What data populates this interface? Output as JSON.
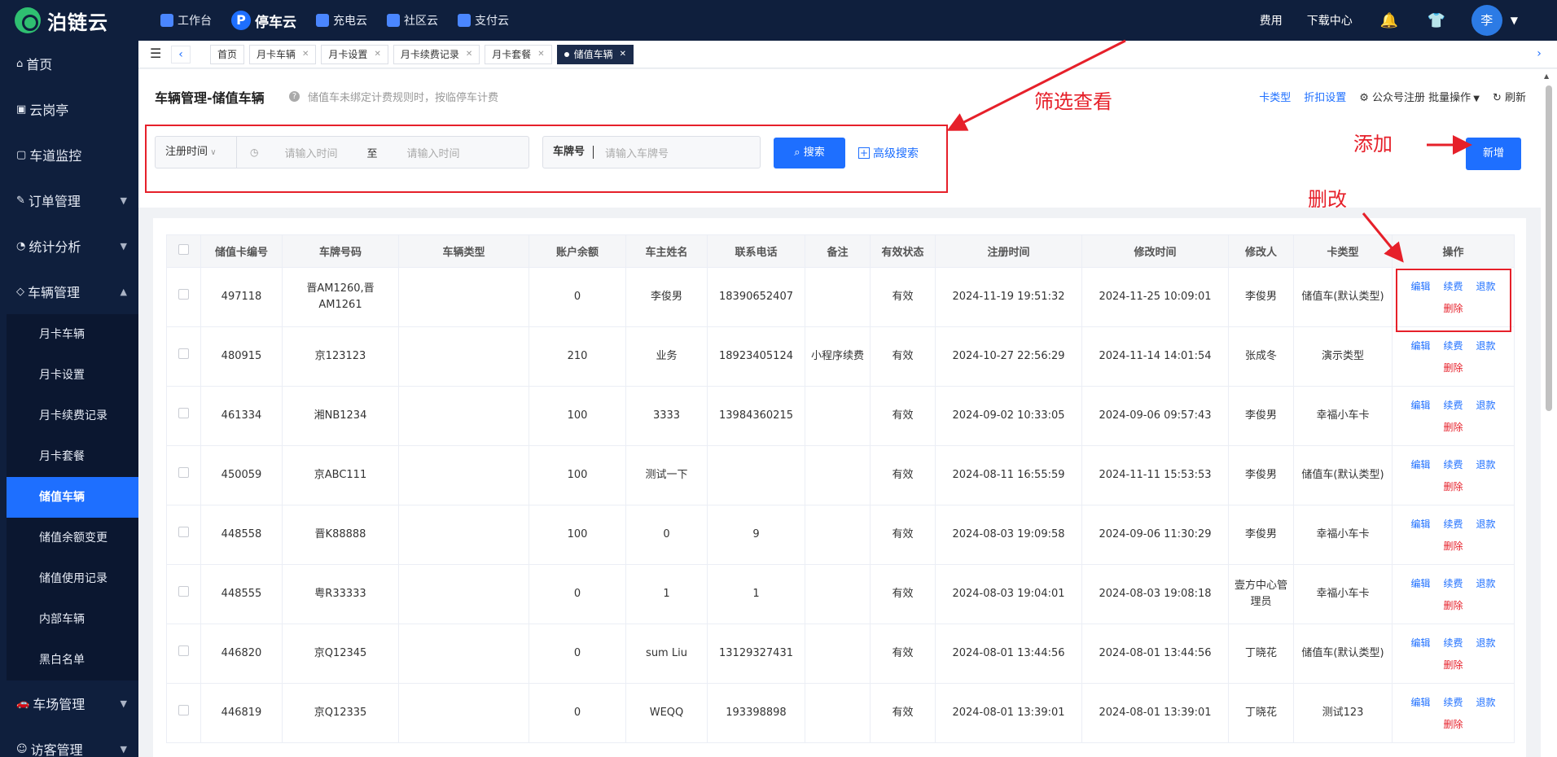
{
  "header": {
    "logo_text": "泊链云",
    "nav": [
      {
        "label": "工作台"
      },
      {
        "label": "停车云",
        "icon_text": "P"
      },
      {
        "label": "充电云"
      },
      {
        "label": "社区云"
      },
      {
        "label": "支付云"
      }
    ],
    "fees": "费用",
    "download": "下载中心",
    "avatar_text": "李"
  },
  "sidebar": {
    "items": {
      "home": "首页",
      "cloud_booth": "云岗亭",
      "lane_monitor": "车道监控",
      "orders": "订单管理",
      "stats": "统计分析",
      "vehicles": "车辆管理",
      "parking": "车场管理",
      "visitors": "访客管理"
    },
    "vehicle_sub": [
      "月卡车辆",
      "月卡设置",
      "月卡续费记录",
      "月卡套餐",
      "储值车辆",
      "储值余额变更",
      "储值使用记录",
      "内部车辆",
      "黑白名单"
    ]
  },
  "tabs": [
    "首页",
    "月卡车辆",
    "月卡设置",
    "月卡续费记录",
    "月卡套餐",
    "储值车辆"
  ],
  "page": {
    "title": "车辆管理-储值车辆",
    "help": "储值车未绑定计费规则时，按临停车计费",
    "links": {
      "card_type": "卡类型",
      "discount": "折扣设置",
      "wechat_reg": "公众号注册",
      "batch": "批量操作",
      "refresh": "刷新"
    }
  },
  "filter": {
    "date_type": "注册时间",
    "start_ph": "请输入时间",
    "to": "至",
    "end_ph": "请输入时间",
    "plate_label": "车牌号",
    "plate_ph": "请输入车牌号",
    "search": "搜索",
    "advanced": "高级搜索"
  },
  "add_button": "新增",
  "annotations": {
    "filter": "筛选查看",
    "add": "添加",
    "edit": "删改"
  },
  "table": {
    "columns": [
      "储值卡编号",
      "车牌号码",
      "车辆类型",
      "账户余额",
      "车主姓名",
      "联系电话",
      "备注",
      "有效状态",
      "注册时间",
      "修改时间",
      "修改人",
      "卡类型",
      "操作"
    ],
    "actions": {
      "edit": "编辑",
      "renew": "续费",
      "refund": "退款",
      "delete": "删除"
    },
    "rows": [
      {
        "id": "497118",
        "plate": "晋AM1260,晋AM1261",
        "vtype": "",
        "balance": "0",
        "owner": "李俊男",
        "phone": "18390652407",
        "note": "",
        "status": "有效",
        "reg": "2024-11-19 19:51:32",
        "mod": "2024-11-25 10:09:01",
        "modifier": "李俊男",
        "ctype": "储值车(默认类型)"
      },
      {
        "id": "480915",
        "plate": "京123123",
        "vtype": "",
        "balance": "210",
        "owner": "业务",
        "phone": "18923405124",
        "note": "小程序续费",
        "status": "有效",
        "reg": "2024-10-27 22:56:29",
        "mod": "2024-11-14 14:01:54",
        "modifier": "张成冬",
        "ctype": "演示类型"
      },
      {
        "id": "461334",
        "plate": "湘NB1234",
        "vtype": "",
        "balance": "100",
        "owner": "3333",
        "phone": "13984360215",
        "note": "",
        "status": "有效",
        "reg": "2024-09-02 10:33:05",
        "mod": "2024-09-06 09:57:43",
        "modifier": "李俊男",
        "ctype": "幸福小车卡"
      },
      {
        "id": "450059",
        "plate": "京ABC111",
        "vtype": "",
        "balance": "100",
        "owner": "测试一下",
        "phone": "",
        "note": "",
        "status": "有效",
        "reg": "2024-08-11 16:55:59",
        "mod": "2024-11-11 15:53:53",
        "modifier": "李俊男",
        "ctype": "储值车(默认类型)"
      },
      {
        "id": "448558",
        "plate": "晋K88888",
        "vtype": "",
        "balance": "100",
        "owner": "0",
        "phone": "9",
        "note": "",
        "status": "有效",
        "reg": "2024-08-03 19:09:58",
        "mod": "2024-09-06 11:30:29",
        "modifier": "李俊男",
        "ctype": "幸福小车卡"
      },
      {
        "id": "448555",
        "plate": "粤R33333",
        "vtype": "",
        "balance": "0",
        "owner": "1",
        "phone": "1",
        "note": "",
        "status": "有效",
        "reg": "2024-08-03 19:04:01",
        "mod": "2024-08-03 19:08:18",
        "modifier": "壹方中心管理员",
        "ctype": "幸福小车卡"
      },
      {
        "id": "446820",
        "plate": "京Q12345",
        "vtype": "",
        "balance": "0",
        "owner": "sum Liu",
        "phone": "13129327431",
        "note": "",
        "status": "有效",
        "reg": "2024-08-01 13:44:56",
        "mod": "2024-08-01 13:44:56",
        "modifier": "丁晓花",
        "ctype": "储值车(默认类型)"
      },
      {
        "id": "446819",
        "plate": "京Q12335",
        "vtype": "",
        "balance": "0",
        "owner": "WEQQ",
        "phone": "193398898",
        "note": "",
        "status": "有效",
        "reg": "2024-08-01 13:39:01",
        "mod": "2024-08-01 13:39:01",
        "modifier": "丁晓花",
        "ctype": "测试123"
      }
    ]
  }
}
